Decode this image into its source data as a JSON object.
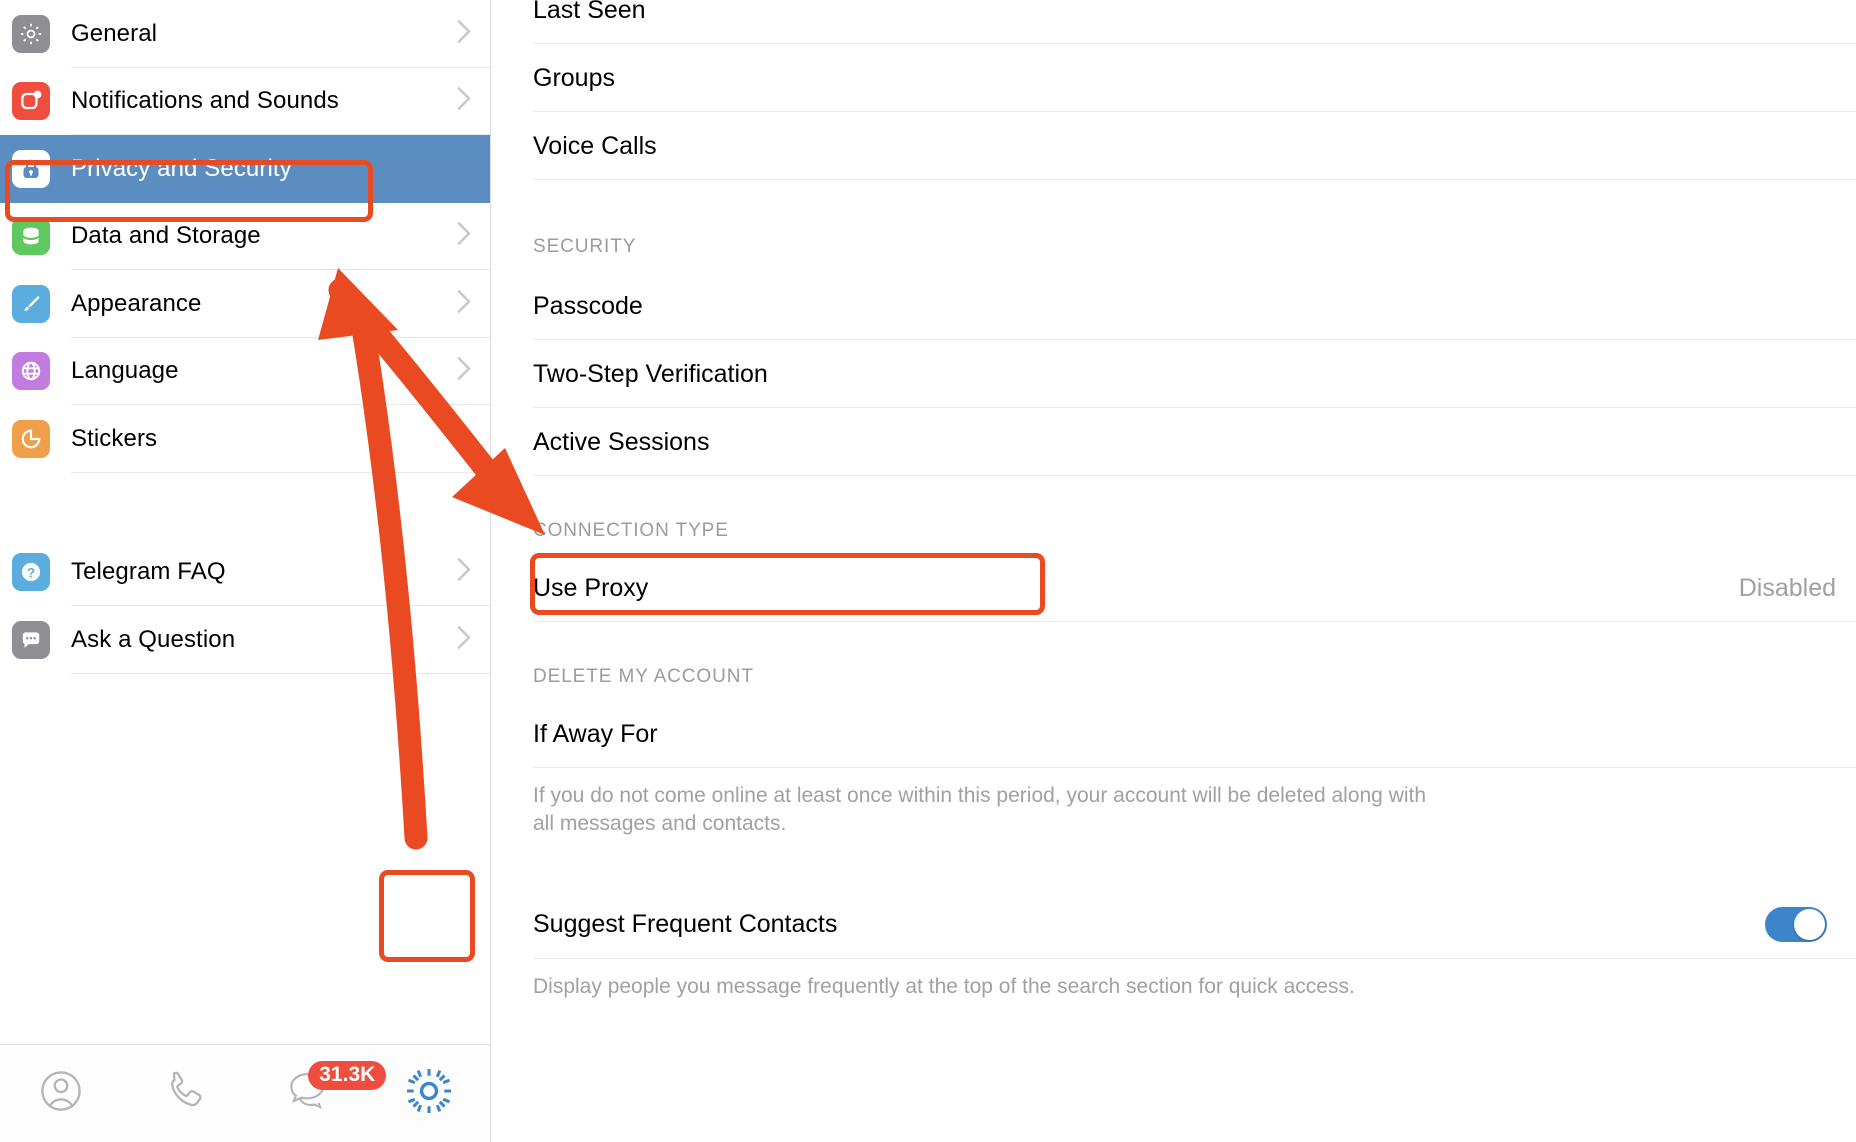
{
  "sidebar": {
    "items": [
      {
        "label": "General",
        "icon": "gear-icon",
        "color": "#8e8e93",
        "chevron": true,
        "selected": false
      },
      {
        "label": "Notifications and Sounds",
        "icon": "bell-badge-icon",
        "color": "#ef4d3d",
        "chevron": true,
        "selected": false
      },
      {
        "label": "Privacy and Security",
        "icon": "lock-icon",
        "color": "#ffffff",
        "chevron": false,
        "selected": true
      },
      {
        "label": "Data and Storage",
        "icon": "database-icon",
        "color": "#5fc95f",
        "chevron": true,
        "selected": false
      },
      {
        "label": "Appearance",
        "icon": "paintbrush-icon",
        "color": "#5aadde",
        "chevron": true,
        "selected": false
      },
      {
        "label": "Language",
        "icon": "globe-icon",
        "color": "#c07ce0",
        "chevron": true,
        "selected": false
      },
      {
        "label": "Stickers",
        "icon": "sticker-icon",
        "color": "#f0a04b",
        "chevron": true,
        "selected": false
      }
    ],
    "help_items": [
      {
        "label": "Telegram FAQ",
        "icon": "question-circle-icon",
        "color": "#5aadde",
        "chevron": true
      },
      {
        "label": "Ask a Question",
        "icon": "chat-bubble-icon",
        "color": "#8e8e93",
        "chevron": true
      }
    ],
    "tabbar": {
      "items": [
        {
          "name": "contacts-tab",
          "icon": "person-circle-icon",
          "active": false,
          "badge": ""
        },
        {
          "name": "calls-tab",
          "icon": "phone-icon",
          "active": false,
          "badge": ""
        },
        {
          "name": "chats-tab",
          "icon": "chats-icon",
          "active": false,
          "badge": "31.3K"
        },
        {
          "name": "settings-tab",
          "icon": "gear-icon",
          "active": true,
          "badge": ""
        }
      ]
    }
  },
  "main": {
    "privacy_rows": [
      {
        "label": "Last Seen",
        "value": ""
      },
      {
        "label": "Groups",
        "value": ""
      },
      {
        "label": "Voice Calls",
        "value": ""
      }
    ],
    "security_header": "SECURITY",
    "security_rows": [
      {
        "label": "Passcode",
        "value": ""
      },
      {
        "label": "Two-Step Verification",
        "value": ""
      },
      {
        "label": "Active Sessions",
        "value": ""
      }
    ],
    "connection_header": "CONNECTION TYPE",
    "connection_rows": [
      {
        "label": "Use Proxy",
        "value": "Disabled"
      }
    ],
    "delete_header": "DELETE MY ACCOUNT",
    "delete_rows": [
      {
        "label": "If Away For",
        "value": ""
      }
    ],
    "delete_note": "If you do not come online at least once within this period, your account will be deleted along with all messages and contacts.",
    "suggest_row": {
      "label": "Suggest Frequent Contacts",
      "toggle_on": true
    },
    "suggest_note": "Display people you message frequently at the top of the search section for quick access."
  },
  "annotations": {
    "accent_color": "#ea4a21",
    "highlights": [
      {
        "name": "highlight-privacy-and-security"
      },
      {
        "name": "highlight-use-proxy"
      },
      {
        "name": "highlight-settings-tab"
      }
    ],
    "arrows": [
      {
        "name": "arrow-to-privacy-and-security"
      },
      {
        "name": "arrow-to-use-proxy"
      }
    ]
  }
}
